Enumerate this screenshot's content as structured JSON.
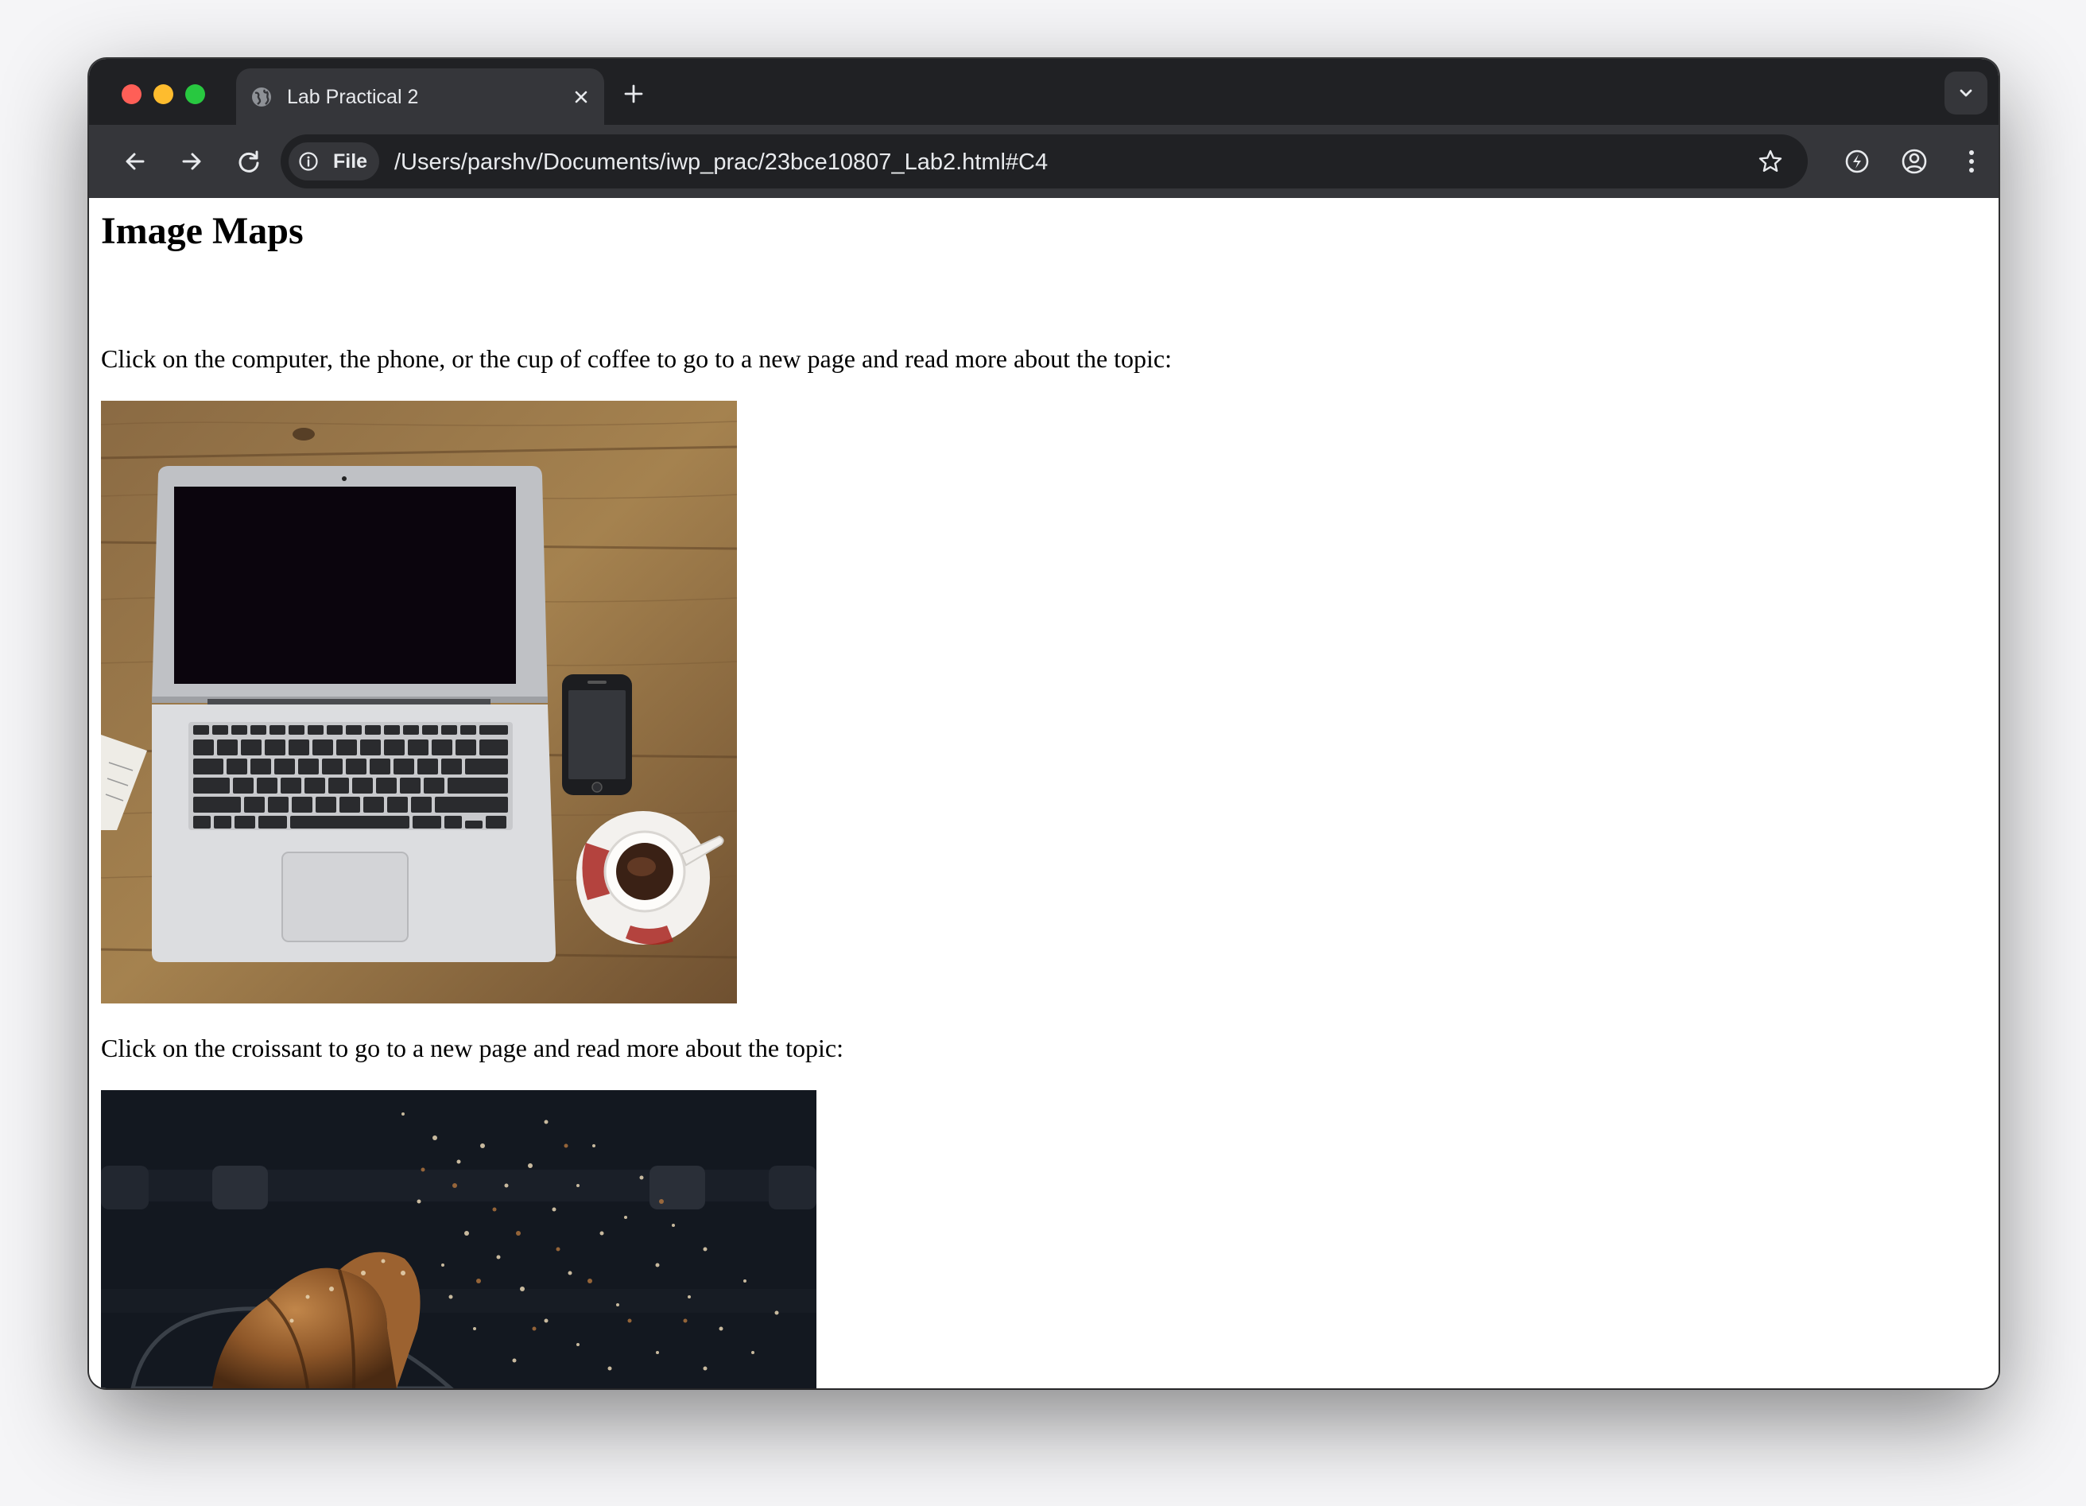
{
  "browser": {
    "tab": {
      "title": "Lab Practical 2"
    },
    "site_chip_label": "File",
    "url": "/Users/parshv/Documents/iwp_prac/23bce10807_Lab2.html#C4"
  },
  "page": {
    "heading": "Image Maps",
    "paragraph1": "Click on the computer, the phone, or the cup of coffee to go to a new page and read more about the topic:",
    "paragraph2": "Click on the croissant to go to a new page and read more about the topic:"
  },
  "icons": {
    "tab_favicon": "globe-icon",
    "tab_close": "close-icon",
    "new_tab": "plus-icon",
    "tab_search": "chevron-down-icon",
    "back": "arrow-left-icon",
    "forward": "arrow-right-icon",
    "reload": "reload-icon",
    "site_info": "info-icon",
    "bookmark": "star-icon",
    "performance": "lightning-icon",
    "profile": "profile-icon",
    "menu": "kebab-menu-icon"
  },
  "colors": {
    "tab_strip": "#202124",
    "toolbar": "#35363a",
    "omnibox": "#202124",
    "browser_text": "#e8eaed",
    "page_background": "#ffffff",
    "traffic_red": "#ff5f57",
    "traffic_yellow": "#febc2e",
    "traffic_green": "#28c840"
  }
}
